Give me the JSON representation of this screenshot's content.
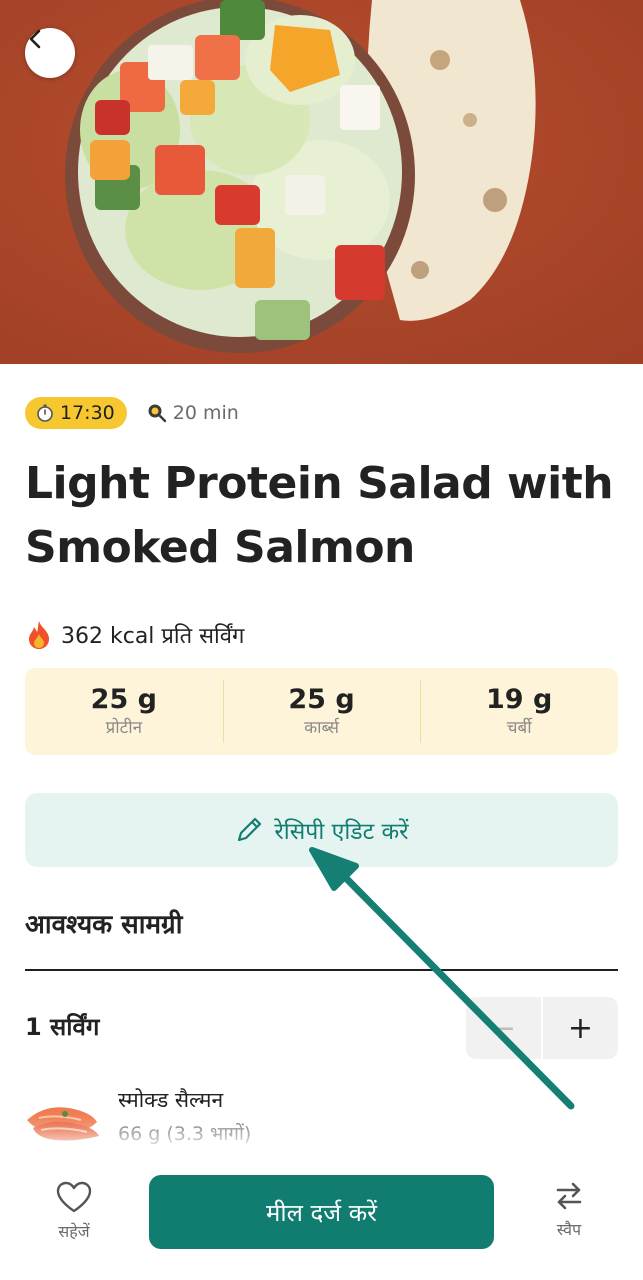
{
  "header": {
    "back_icon": "chevron-left-icon"
  },
  "meta": {
    "time": "17:30",
    "time_icon": "stopwatch-icon",
    "duration": "20 min",
    "duration_icon": "pan-icon"
  },
  "recipe": {
    "title": "Light Protein Salad with Smoked Salmon"
  },
  "nutrition": {
    "kcal_icon": "fire-icon",
    "kcal_text": "362 kcal प्रति सर्विंग",
    "macros": [
      {
        "value": "25 g",
        "label": "प्रोटीन"
      },
      {
        "value": "25 g",
        "label": "कार्ब्स"
      },
      {
        "value": "19 g",
        "label": "चर्बी"
      }
    ]
  },
  "edit": {
    "label": "रेसिपी एडिट करें",
    "icon": "pencil-icon"
  },
  "ingredients": {
    "title": "आवश्यक सामग्री",
    "servings": "1 सर्विंग",
    "minus": "−",
    "plus": "+",
    "items": [
      {
        "name": "स्मोक्ड सैल्मन",
        "amount": "66 g (3.3 भागों)"
      }
    ]
  },
  "bottom_bar": {
    "save_label": "सहेजें",
    "log_label": "मील दर्ज करें",
    "swap_label": "स्वैप"
  },
  "colors": {
    "accent": "#117d71",
    "badge": "#f6c72f",
    "macros_bg": "#fdf4da",
    "edit_bg": "#e6f4f1",
    "hero_bg": "#b1482b"
  }
}
